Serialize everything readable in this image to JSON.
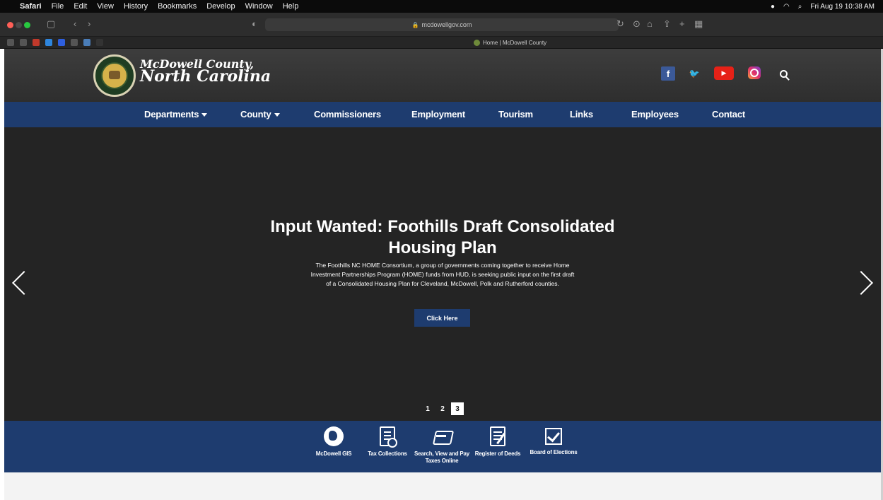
{
  "menubar": {
    "apple": "",
    "app": "Safari",
    "items": [
      "File",
      "Edit",
      "View",
      "History",
      "Bookmarks",
      "Develop",
      "Window",
      "Help"
    ],
    "clock": "Fri Aug 19  10:38 AM"
  },
  "browser": {
    "address": "mcdowellgov.com",
    "tab_title": "Home | McDowell County"
  },
  "site": {
    "title_line1": "McDowell County,",
    "title_line2": "North Carolina",
    "social": {
      "facebook": "f",
      "youtube": "▶"
    }
  },
  "nav": {
    "items": [
      "Departments",
      "County",
      "Commissioners",
      "Employment",
      "Tourism",
      "Links",
      "Employees",
      "Contact"
    ]
  },
  "hero": {
    "title": "Input Wanted: Foothills Draft Consolidated Housing Plan",
    "description": "The Foothills NC HOME Consortium, a group of governments coming together to receive Home Investment Partnerships Program (HOME) funds from HUD, is seeking public input on the first draft of a Consolidated Housing Plan for Cleveland, McDowell, Polk and Rutherford counties.",
    "button": "Click Here",
    "pages": [
      "1",
      "2",
      "3"
    ],
    "active_page": 3
  },
  "quick_links": [
    {
      "label": "McDowell GIS",
      "icon": "globe-icon"
    },
    {
      "label": "Tax Collections",
      "icon": "tax-document-icon"
    },
    {
      "label": "Search, View and Pay Taxes Online",
      "icon": "payment-card-icon"
    },
    {
      "label": "Register of Deeds",
      "icon": "notepad-icon"
    },
    {
      "label": "Board of Elections",
      "icon": "checkbox-icon"
    }
  ],
  "colors": {
    "nav_blue": "#1e3c6f",
    "header_gray": "#3d3d3d",
    "hero_bg": "#242424",
    "facebook": "#3b5998",
    "youtube": "#e62117"
  }
}
